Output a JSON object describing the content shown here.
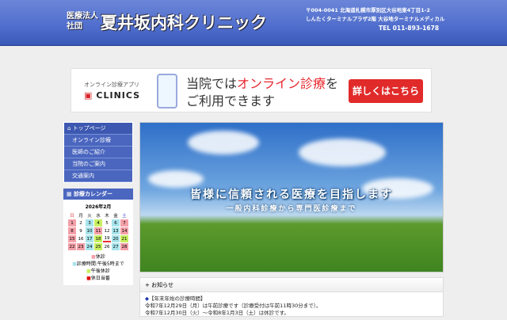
{
  "header": {
    "corp_type": [
      "医療法人",
      "社団"
    ],
    "clinic_name": "夏井坂内科クリニック",
    "address": [
      "〒004-0041 北海道札幌市厚別区大谷地東4丁目1-2",
      "しんたくターミナルプラザ2階 大谷地ターミナルメディカル"
    ],
    "tel": "TEL 011-893-1678"
  },
  "banner": {
    "app_label": "オンライン診療アプリ",
    "app_name": "CLINICS",
    "text_pre": "当院では",
    "text_hl": "オンライン診療",
    "text_post": "を",
    "text_line2": "ご利用できます",
    "button": "詳しくはこちら"
  },
  "nav": {
    "items": [
      "トップページ",
      "オンライン診療",
      "医師のご紹介",
      "当院のご案内",
      "交通案内"
    ]
  },
  "calendar": {
    "title": "診療カレンダー",
    "month": "2026年2月",
    "weekdays": [
      "日",
      "月",
      "火",
      "水",
      "木",
      "金",
      "土"
    ],
    "weeks": [
      [
        "1",
        "2",
        "3",
        "4",
        "5",
        "6",
        "7"
      ],
      [
        "8",
        "9",
        "10",
        "11",
        "12",
        "13",
        "14"
      ],
      [
        "15",
        "16",
        "17",
        "18",
        "19",
        "20",
        "21"
      ],
      [
        "22",
        "23",
        "24",
        "25",
        "26",
        "27",
        "28"
      ]
    ],
    "legend": [
      "休診",
      "診療時間:午後5時まで",
      "午後休診",
      "休日当番"
    ],
    "colors": {
      "closed": "#f4a0a8",
      "until5": "#a8e4ec",
      "am_only": "#c8f060",
      "duty": "#dd1111"
    }
  },
  "hero": {
    "title": "皆様に信頼される医療を目指します",
    "subtitle": "一般内科診療から専門医診療まで"
  },
  "news": {
    "heading": "お知らせ",
    "item_title": "【年末年始の診療時間】",
    "lines": [
      "令和7年12月29日（月）は午前診療です（診療受付は午前11時30分まで）。",
      "令和7年12月30日（火）～令和8年1月3日（土）は休診です。"
    ]
  }
}
